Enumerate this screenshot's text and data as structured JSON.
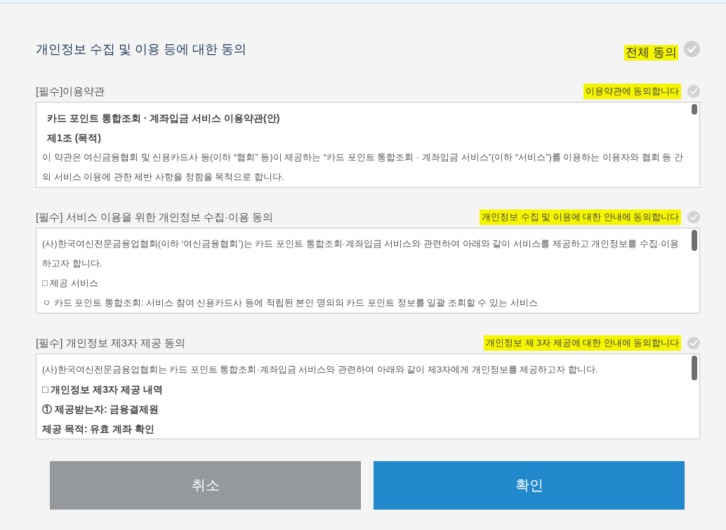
{
  "title": "개인정보 수집 및 이용 등에 대한 동의",
  "all_agree": {
    "label": "전체 동의",
    "checked": false,
    "highlighted": true
  },
  "sections": [
    {
      "label": "[필수]이용약관",
      "agree": {
        "label": "이용약관에 동의합니다",
        "checked": false,
        "highlighted": true
      },
      "paragraphs": [
        {
          "kind": "title",
          "text": "카드 포인트 통합조회 · 계좌입금 서비스 이용약관(안)"
        },
        {
          "kind": "title",
          "text": "제1조 (목적)"
        },
        {
          "kind": "text",
          "text": "이 약관은 여신금융협회 및 신용카드사 등(이하 “협회” 등)이 제공하는 “카드 포인트 통합조회 · 계좌입금 서비스”(이하 “서비스”)를 이용하는 이용자와 협회 등 간의 서비스 이용에 관한 제반 사항을 정함을 목적으로 합니다."
        }
      ]
    },
    {
      "label": "[필수] 서비스 이용을 위한 개인정보 수집·이용 동의",
      "agree": {
        "label": "개인정보 수집 및 이용에 대한 안내에 동의합니다",
        "checked": false,
        "highlighted": true
      },
      "paragraphs": [
        {
          "kind": "text",
          "text": "(사)한국여신전문금융업협회(이하 ‘여신금융협회’)는 카드 포인트 통합조회·계좌입금 서비스와 관련하여 아래와 같이 서비스를 제공하고 개인정보를 수집·이용하고자 합니다."
        },
        {
          "kind": "text",
          "text": "□ 제공 서비스"
        },
        {
          "kind": "text",
          "text": "ㅇ 카드 포인트 통합조회: 서비스 참여 신용카드사 등에 적립된 본인 명의의 카드 포인트 정보를 일괄 조회할 수 있는 서비스"
        }
      ]
    },
    {
      "label": "[필수] 개인정보 제3자 제공 동의",
      "agree": {
        "label": "개인정보 제 3자 제공에 대한 안내에 동의합니다",
        "checked": false,
        "highlighted": true
      },
      "paragraphs": [
        {
          "kind": "text",
          "text": "(사)한국여신전문금융업협회는 카드 포인트 통합조회·계좌입금 서비스와 관련하여 아래와 같이 제3자에게 개인정보를 제공하고자 합니다."
        },
        {
          "kind": "bold",
          "text": "□ 개인정보 제3자 제공 내역"
        },
        {
          "kind": "bold",
          "text": "① 제공받는자: 금융결제원"
        },
        {
          "kind": "bold",
          "text": "제공 목적: 유효 계좌 확인"
        }
      ]
    }
  ],
  "buttons": [
    {
      "kind": "cancel",
      "label": "취소"
    },
    {
      "kind": "confirm",
      "label": "확인"
    }
  ]
}
